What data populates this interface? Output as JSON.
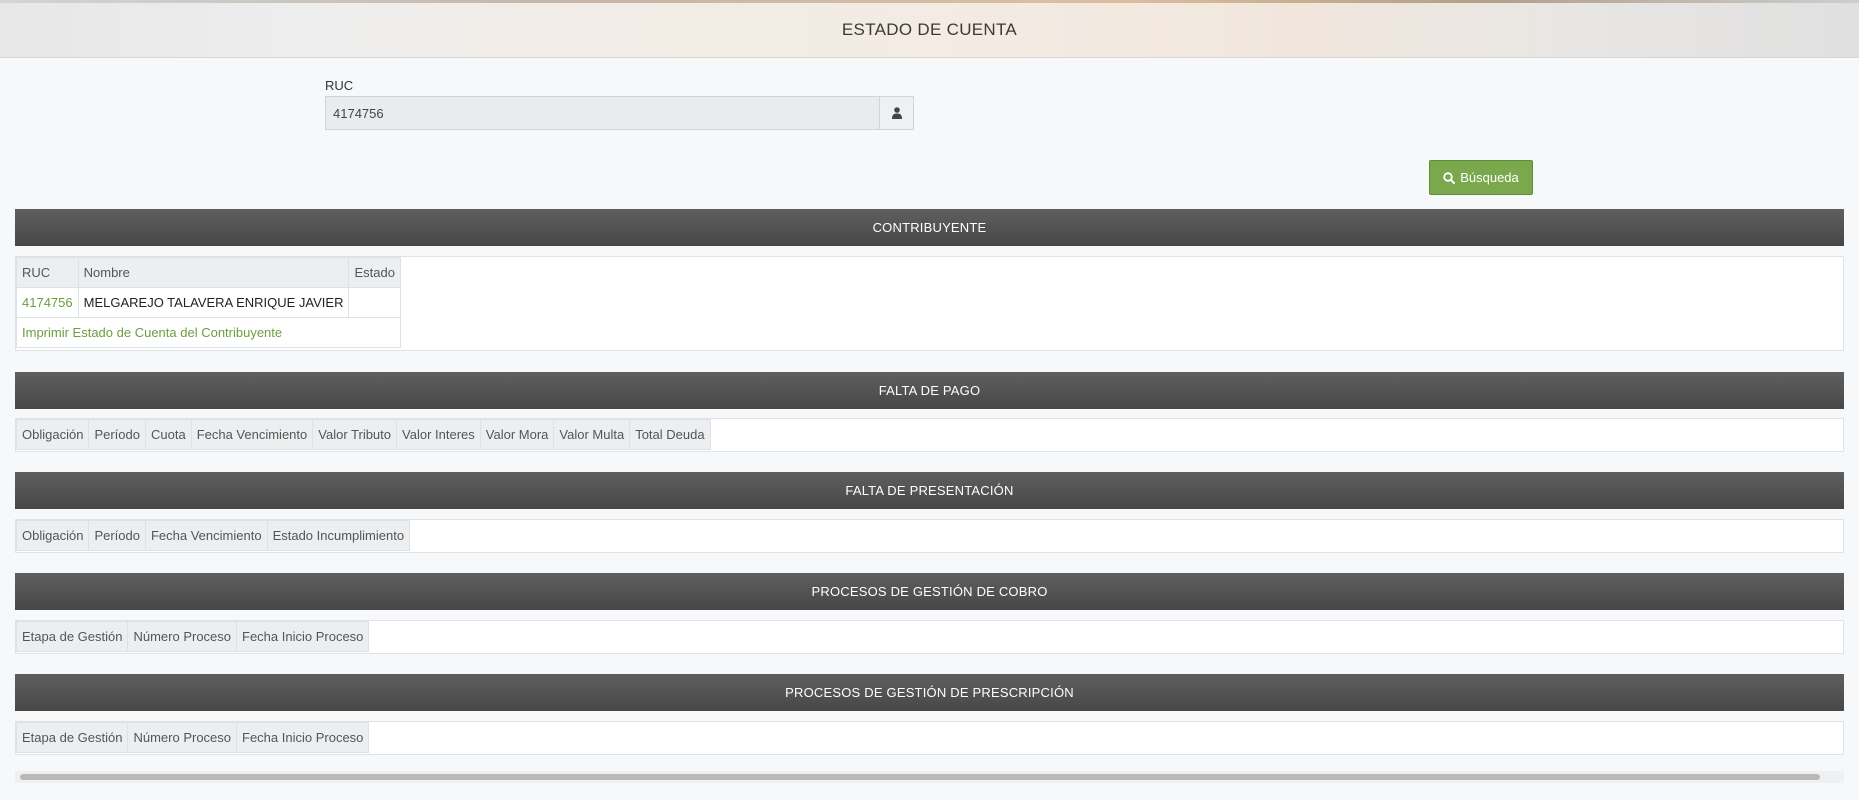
{
  "header": {
    "title": "ESTADO DE CUENTA"
  },
  "search": {
    "ruc_label": "RUC",
    "ruc_value": "4174756",
    "addon_icon": "user-icon",
    "button_label": "Búsqueda",
    "button_icon": "search-icon"
  },
  "colors": {
    "accent_green": "#7aa84c",
    "link_green": "#6c9f3d",
    "section_bar": "#4f4f4f"
  },
  "contribuyente": {
    "title": "CONTRIBUYENTE",
    "headers": [
      "RUC",
      "Nombre",
      "Estado"
    ],
    "row": {
      "ruc": "4174756",
      "nombre": "MELGAREJO TALAVERA ENRIQUE JAVIER",
      "estado": ""
    },
    "print_link": "Imprimir Estado de Cuenta del Contribuyente"
  },
  "falta_pago": {
    "title": "FALTA DE PAGO",
    "headers": [
      "Obligación",
      "Período",
      "Cuota",
      "Fecha Vencimiento",
      "Valor Tributo",
      "Valor Interes",
      "Valor Mora",
      "Valor Multa",
      "Total Deuda"
    ]
  },
  "falta_presentacion": {
    "title": "FALTA DE PRESENTACIÓN",
    "headers": [
      "Obligación",
      "Período",
      "Fecha Vencimiento",
      "Estado Incumplimiento"
    ]
  },
  "gestion_cobro": {
    "title": "PROCESOS DE GESTIÓN DE COBRO",
    "headers": [
      "Etapa de Gestión",
      "Número Proceso",
      "Fecha Inicio Proceso"
    ]
  },
  "gestion_prescripcion": {
    "title": "PROCESOS DE GESTIÓN DE PRESCRIPCIÓN",
    "headers": [
      "Etapa de Gestión",
      "Número Proceso",
      "Fecha Inicio Proceso"
    ]
  }
}
